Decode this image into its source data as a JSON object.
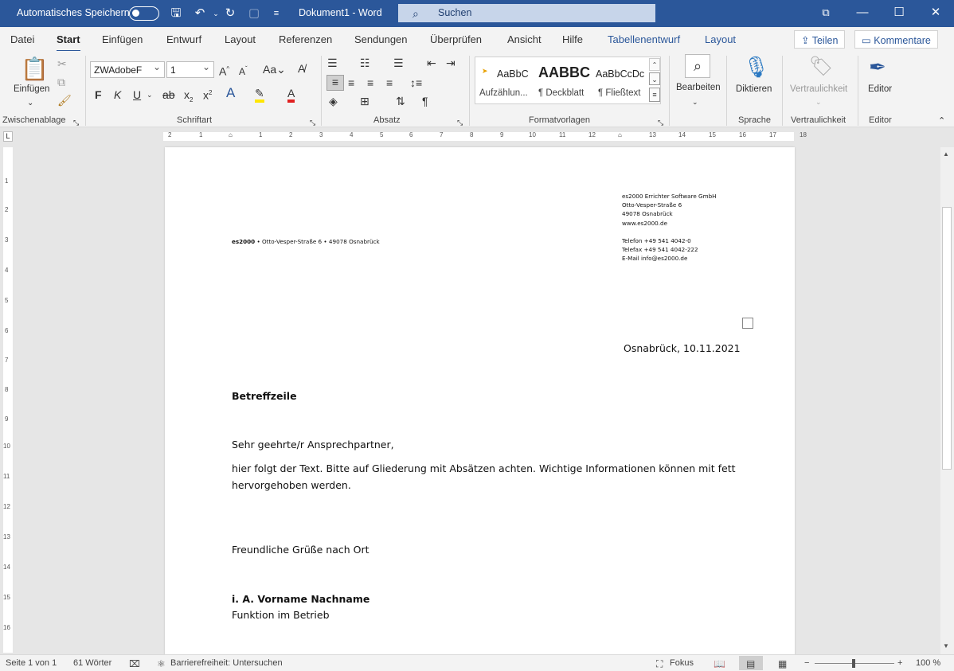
{
  "titlebar": {
    "autosave_label": "Automatisches Speichern",
    "doc_title": "Dokument1  -  Word",
    "search_label": "Suchen"
  },
  "tabs": [
    "Datei",
    "Start",
    "Einfügen",
    "Entwurf",
    "Layout",
    "Referenzen",
    "Sendungen",
    "Überprüfen",
    "Ansicht",
    "Hilfe",
    "Tabellenentwurf",
    "Layout"
  ],
  "share_button": "Teilen",
  "comments_button": "Kommentare",
  "ribbon": {
    "clipboard": {
      "paste_label": "Einfügen",
      "group": "Zwischenablage"
    },
    "font": {
      "name": "ZWAdobeF",
      "size": "1",
      "group": "Schriftart"
    },
    "paragraph": {
      "group": "Absatz"
    },
    "styles": {
      "group": "Formatvorlagen",
      "items": [
        {
          "preview": "AaBbC",
          "name": "Aufzählun..."
        },
        {
          "preview": "AABBC",
          "name": "¶ Deckblatt"
        },
        {
          "preview": "AaBbCcDc",
          "name": "¶ Fließtext"
        }
      ]
    },
    "editing": {
      "label": "Bearbeiten"
    },
    "voice": {
      "label": "Diktieren",
      "group": "Sprache"
    },
    "sensitivity": {
      "label": "Vertraulichkeit",
      "group": "Vertraulichkeit"
    },
    "editor": {
      "label": "Editor",
      "group": "Editor"
    }
  },
  "ruler": {
    "h": [
      "2",
      "1",
      "1",
      "2",
      "3",
      "4",
      "5",
      "6",
      "7",
      "8",
      "9",
      "10",
      "11",
      "12",
      "13",
      "14",
      "15",
      "16",
      "17",
      "18"
    ],
    "v": [
      "1",
      "2",
      "3",
      "4",
      "5",
      "6",
      "7",
      "8",
      "9",
      "10",
      "11",
      "12",
      "13",
      "14",
      "15",
      "16"
    ]
  },
  "document": {
    "sender_line_bold": "es2000",
    "sender_line": " • Otto-Vesper-Straße 6 • 49078 Osnabrück",
    "company": [
      "es2000 Errichter Software GmbH",
      "Otto-Vesper-Straße 6",
      "49078 Osnabrück",
      "www.es2000.de",
      "",
      "Telefon +49 541 4042-0",
      "Telefax +49 541 4042-222",
      "E-Mail info@es2000.de"
    ],
    "date": "Osnabrück, 10.11.2021",
    "subject": "Betreffzeile",
    "salutation": "Sehr geehrte/r Ansprechpartner,",
    "body_line1": "hier folgt der Text. Bitte auf Gliederung mit Absätzen achten. Wichtige Informationen können mit fett",
    "body_line2": "hervorgehoben werden.",
    "closing": "Freundliche Grüße nach Ort",
    "signer": "i. A. Vorname Nachname",
    "function": "Funktion im Betrieb"
  },
  "status": {
    "page": "Seite 1 von 1",
    "words": "61 Wörter",
    "accessibility": "Barrierefreiheit: Untersuchen",
    "focus": "Fokus",
    "zoom": "100 %"
  }
}
